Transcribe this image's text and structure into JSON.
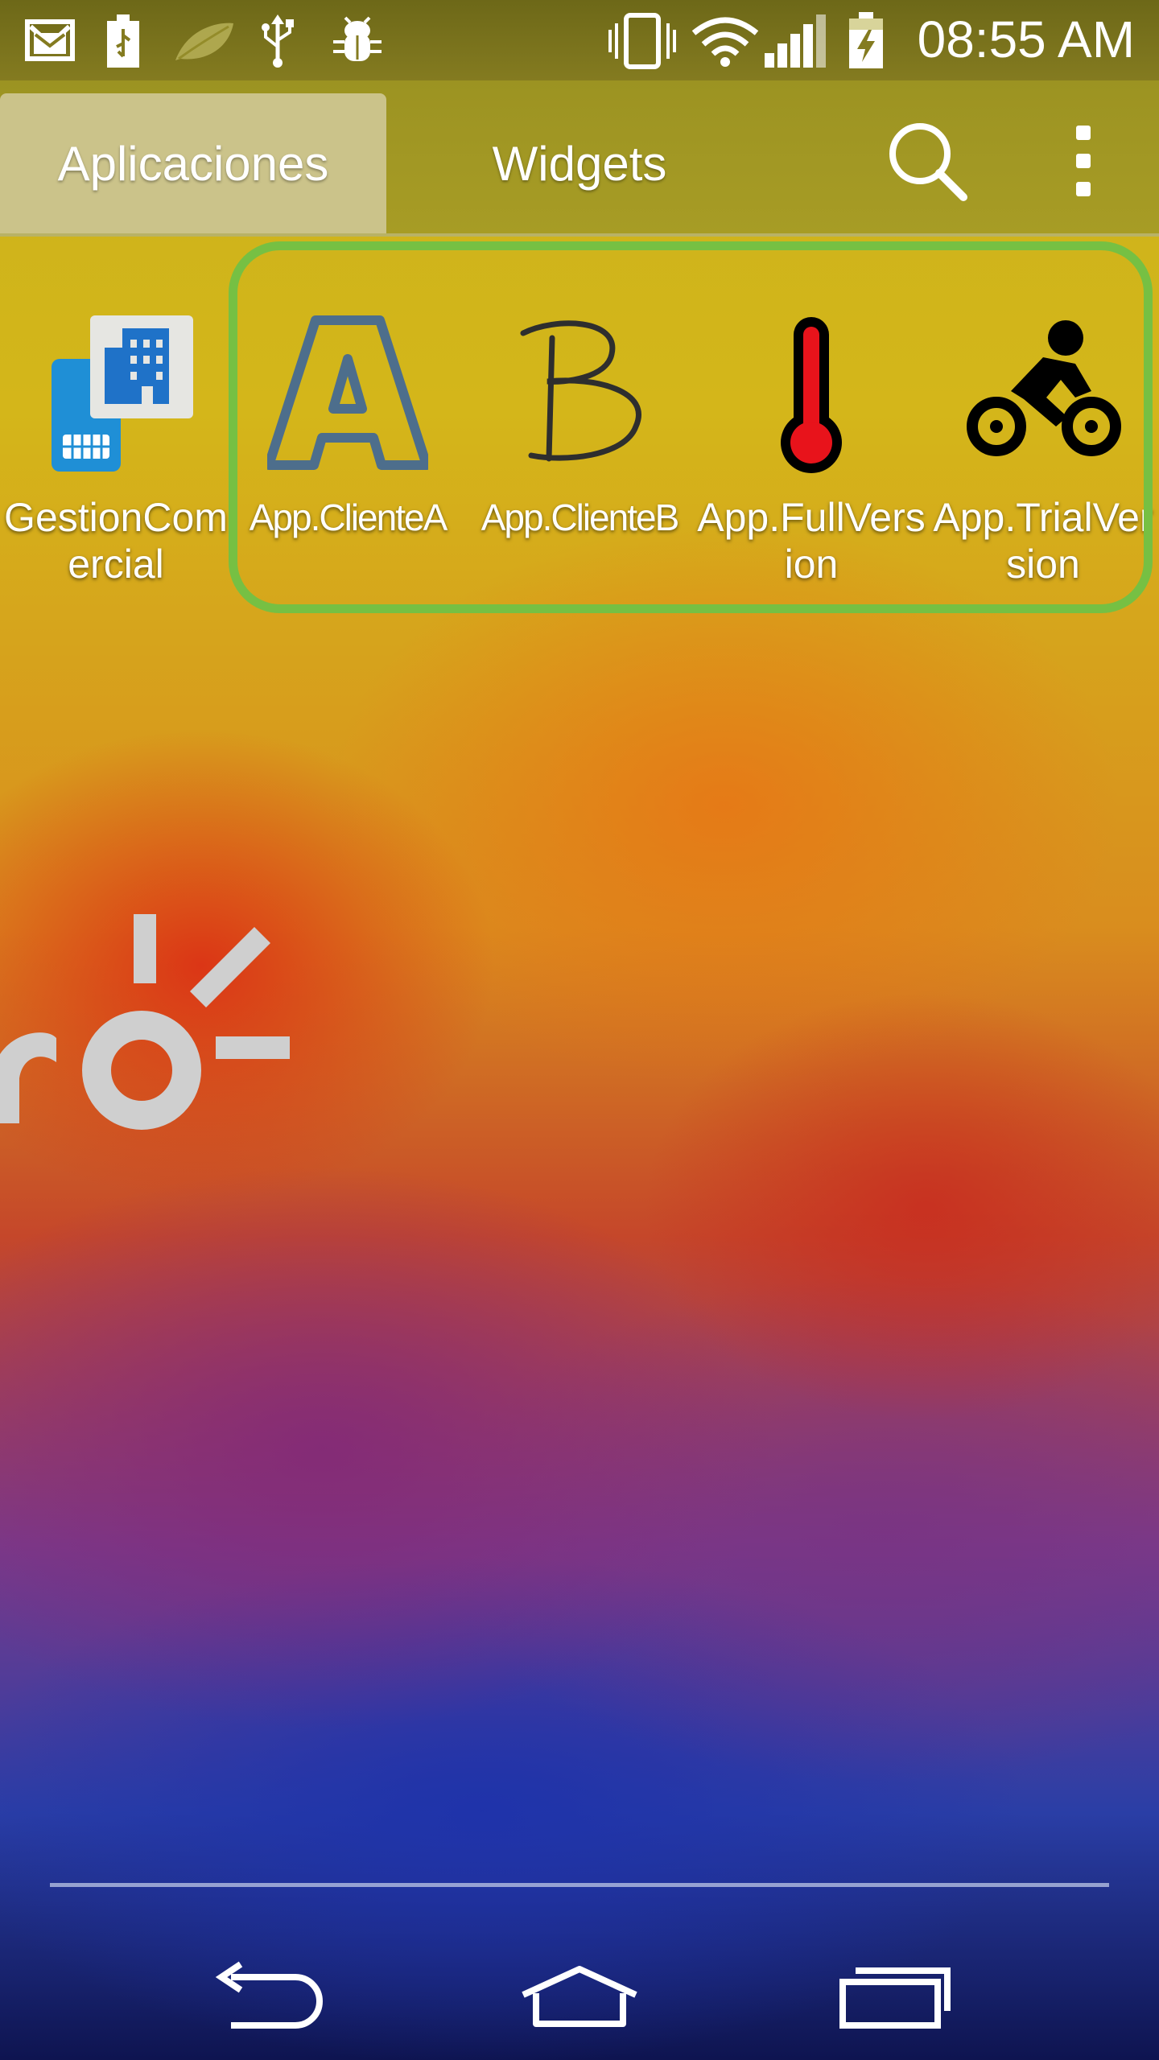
{
  "status_bar": {
    "time": "08:55 AM",
    "left_icons": [
      "gmail-icon",
      "usb-storage-icon",
      "leaf-icon",
      "usb-icon",
      "android-debug-icon"
    ],
    "right_icons": [
      "vibrate-icon",
      "wifi-icon",
      "signal-icon",
      "battery-charging-icon"
    ]
  },
  "tabs": {
    "apps_label": "Aplicaciones",
    "widgets_label": "Widgets"
  },
  "toolbar": {
    "search_icon": "search-icon",
    "menu_icon": "overflow-menu-icon"
  },
  "apps": [
    {
      "label": "GestionComercial",
      "icon": "gestion-comercial-icon"
    },
    {
      "label": "App.ClienteA",
      "icon": "letter-a-icon"
    },
    {
      "label": "App.ClienteB",
      "icon": "letter-b-icon"
    },
    {
      "label": "App.FullVersion",
      "icon": "thermometer-icon"
    },
    {
      "label": "App.TrialVersion",
      "icon": "cyclist-icon"
    }
  ],
  "highlight_color": "#76c043",
  "wallpaper": {
    "logo_icon": "claro-logo"
  },
  "nav": {
    "back_icon": "back-icon",
    "home_icon": "home-icon",
    "recents_icon": "recents-icon"
  }
}
